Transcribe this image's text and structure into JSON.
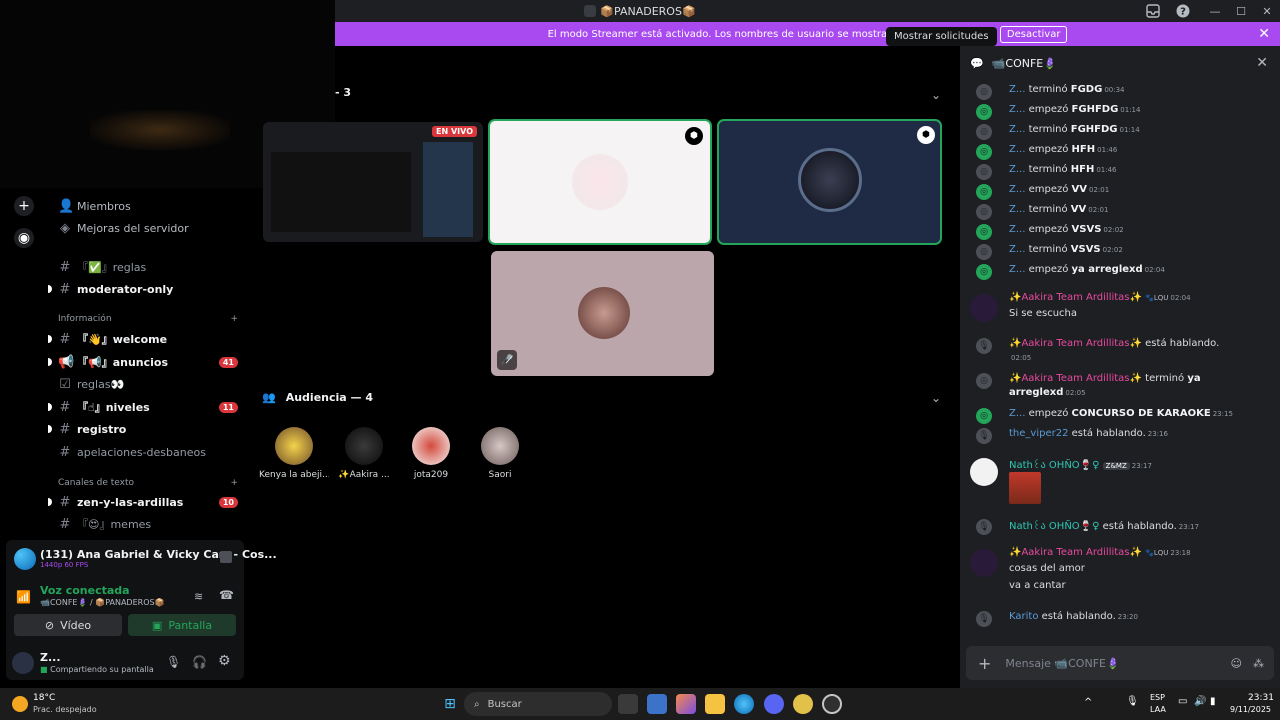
{
  "window": {
    "title": "📦PANADEROS📦"
  },
  "banner": {
    "text": "El modo Streamer está activado. Los nombres de usuario se mostrarán de forma parcial.",
    "button": "Desactivar"
  },
  "tooltip": "Mostrar solicitudes",
  "sidebar": {
    "items": [
      {
        "label": "Miembros"
      },
      {
        "label": "Mejoras del servidor"
      }
    ],
    "channels": [
      {
        "name": "『✅』reglas",
        "bold": false,
        "badge": ""
      },
      {
        "name": "moderator-only",
        "bold": true,
        "badge": ""
      }
    ],
    "cat_info": "Información",
    "info_channels": [
      {
        "name": "『👋』welcome",
        "bold": true,
        "badge": ""
      },
      {
        "name": "『📢』anuncios",
        "bold": true,
        "badge": "41"
      },
      {
        "name": "reglas👀",
        "bold": false,
        "badge": ""
      },
      {
        "name": "『☝』niveles",
        "bold": true,
        "badge": "11"
      },
      {
        "name": "registro",
        "bold": true,
        "badge": ""
      },
      {
        "name": "apelaciones-desbaneos",
        "bold": false,
        "badge": ""
      }
    ],
    "cat_text": "Canales de texto",
    "text_channels": [
      {
        "name": "zen-y-las-ardillas",
        "bold": true,
        "badge": "10"
      },
      {
        "name": "『😍』memes",
        "bold": false,
        "badge": ""
      }
    ]
  },
  "stream_panel": {
    "title": "(131) Ana Gabriel & Vicky Carr - Cos...",
    "quality": "1440p 60 FPS",
    "voice_title": "Voz conectada",
    "voice_sub": "📹CONFE🪻 / 📦PANADEROS📦",
    "video_label": "Vídeo",
    "screen_label": "Pantalla"
  },
  "user": {
    "name": "Z...",
    "status": "Compartiendo su pantalla"
  },
  "stage": {
    "header_suffix": "- 3",
    "live": "EN VIVO",
    "audience_label": "Audiencia — 4",
    "audience": [
      {
        "name": "Kenya la abeji..."
      },
      {
        "name": "✨Aakira ..."
      },
      {
        "name": "jota209"
      },
      {
        "name": "Saori"
      }
    ]
  },
  "chat": {
    "title": "📹CONFE🪻",
    "input_placeholder": "Mensaje 📹CONFE🪻",
    "events": [
      {
        "who": "Z...",
        "verb": "terminó",
        "obj": "FGDG",
        "ts": "00:34",
        "kind": "grey"
      },
      {
        "who": "Z...",
        "verb": "empezó",
        "obj": "FGHFDG",
        "ts": "01:14",
        "kind": "green"
      },
      {
        "who": "Z...",
        "verb": "terminó",
        "obj": "FGHFDG",
        "ts": "01:14",
        "kind": "grey"
      },
      {
        "who": "Z...",
        "verb": "empezó",
        "obj": "HFH",
        "ts": "01:46",
        "kind": "green"
      },
      {
        "who": "Z...",
        "verb": "terminó",
        "obj": "HFH",
        "ts": "01:46",
        "kind": "grey"
      },
      {
        "who": "Z...",
        "verb": "empezó",
        "obj": "VV",
        "ts": "02:01",
        "kind": "green"
      },
      {
        "who": "Z...",
        "verb": "terminó",
        "obj": "VV",
        "ts": "02:01",
        "kind": "grey"
      },
      {
        "who": "Z...",
        "verb": "empezó",
        "obj": "VSVS",
        "ts": "02:02",
        "kind": "green"
      },
      {
        "who": "Z...",
        "verb": "terminó",
        "obj": "VSVS",
        "ts": "02:02",
        "kind": "grey"
      },
      {
        "who": "Z...",
        "verb": "empezó",
        "obj": "ya arreglexd",
        "ts": "02:04",
        "kind": "green"
      }
    ],
    "aakira_name": "✨Aakira Team Ardillitas✨",
    "aakira_tag": "🐾LQU",
    "msg1_ts": "02:04",
    "msg1_text": "Si se escucha",
    "speaking_1": "está hablando.",
    "speaking_1_ts": "02:05",
    "ended_verb": "terminó",
    "ended_obj1": "ya",
    "ended_obj2": "arreglexd",
    "ended_ts": "02:05",
    "z_started": "Z...",
    "karaoke_verb": "empezó",
    "karaoke_obj": "CONCURSO DE KARAOKE",
    "karaoke_ts": "23:15",
    "viper": "the_viper22",
    "viper_text": "está hablando.",
    "viper_ts": "23:16",
    "nath_name": "Nath꒰ა OHÑO🍷♀",
    "nath_tag": "Z&MZ",
    "nath_ts": "23:17",
    "nath_speaking": "está hablando.",
    "nath_speaking_ts": "23:17",
    "msg2_ts": "23:18",
    "msg2_line1": "cosas del amor",
    "msg2_line2": "va a cantar",
    "karito": "Karito",
    "karito_text": "está hablando.",
    "karito_ts": "23:20"
  },
  "taskbar": {
    "weather_temp": "18°C",
    "weather_desc": "Prac. despejado",
    "search": "Buscar",
    "lang1": "ESP",
    "lang2": "LAA",
    "time": "23:31",
    "date": "9/11/2025"
  }
}
